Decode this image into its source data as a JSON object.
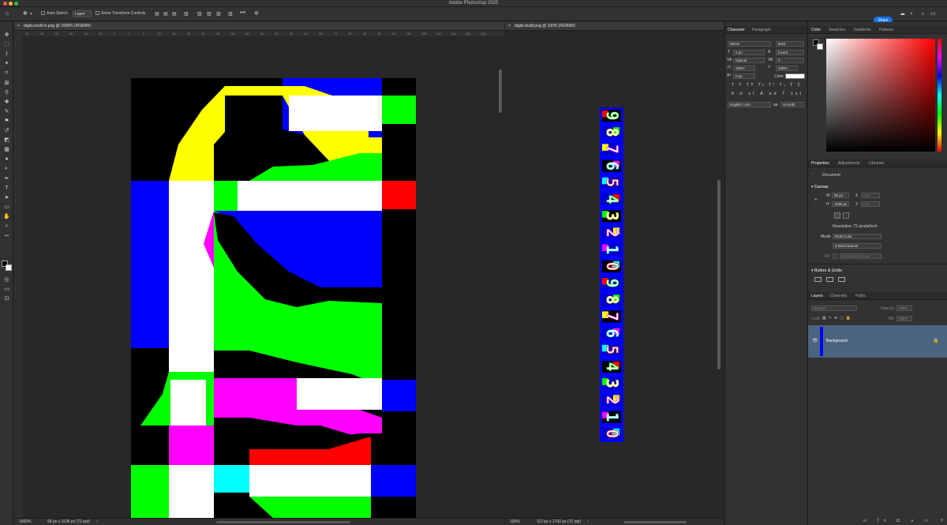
{
  "app": {
    "title": "Adobe Photoshop 2025"
  },
  "options_bar": {
    "auto_select_label": "Auto-Select:",
    "auto_select_value": "Layer",
    "show_transform_label": "Show Transform Controls",
    "share_label": "Share"
  },
  "tools": [
    "move-tool",
    "marquee-tool",
    "lasso-tool",
    "magic-wand-tool",
    "crop-tool",
    "frame-tool",
    "eyedropper-tool",
    "healing-tool",
    "brush-tool",
    "stamp-tool",
    "history-brush-tool",
    "eraser-tool",
    "gradient-tool",
    "blur-tool",
    "dodge-tool",
    "pen-tool",
    "type-tool",
    "path-select-tool",
    "rectangle-tool",
    "hand-tool",
    "zoom-tool",
    "more-tools"
  ],
  "doc_left": {
    "tab_label": "digits.msdf.m.png @ 1600% (RGB/8#)",
    "ruler_ticks": [
      "35",
      "30",
      "25",
      "20",
      "15",
      "10",
      "5",
      "0",
      "5",
      "10",
      "15",
      "20",
      "25",
      "30",
      "35",
      "40",
      "45",
      "50",
      "55",
      "60",
      "65",
      "70",
      "75",
      "80",
      "85",
      "90",
      "95",
      "100",
      "105",
      "110",
      "115",
      "120"
    ],
    "zoom": "1600%",
    "info": "96 px x 1536 px (72 ppi)"
  },
  "doc_right": {
    "tab_label": "digits.msdf.png @ 100% (RGB/8#)",
    "zoom": "100%",
    "info": "112 px x 1792 px (72 ppi)",
    "glyphs": [
      "9",
      "8",
      "7",
      "6",
      "5",
      "4",
      "3",
      "2",
      "1",
      "0",
      "9",
      "8",
      "7",
      "6",
      "5",
      "4",
      "3",
      "2",
      "1",
      "0"
    ]
  },
  "character_panel": {
    "tabs": [
      "Character",
      "Paragraph"
    ],
    "font_family": "Menlo",
    "font_style": "Bold",
    "font_size": "2 px",
    "leading": "(Auto)",
    "kerning": "Optical",
    "tracking": "0",
    "vscale": "100%",
    "hscale": "100%",
    "baseline": "0 px",
    "color_label": "Color:",
    "language": "English: USA",
    "aa_label": "aa",
    "antialias": "Smooth"
  },
  "color_panel": {
    "tabs": [
      "Color",
      "Swatches",
      "Gradients",
      "Patterns"
    ],
    "hue": "#ff0000"
  },
  "properties_panel": {
    "tabs": [
      "Properties",
      "Adjustments",
      "Libraries"
    ],
    "document_label": "Document",
    "canvas_label": "Canvas",
    "w_label": "W",
    "w_value": "96 px",
    "x_label": "X",
    "x_placeholder": "0 px",
    "h_label": "H",
    "h_value": "1536 px",
    "y_label": "Y",
    "y_placeholder": "0 px",
    "resolution": "Resolution: 72 pixels/inch",
    "mode_label": "Mode",
    "mode_value": "RGB Color",
    "depth_value": "8 Bits/Channel",
    "fill_label": "Fill",
    "fill_value": "Background Color",
    "rulers_label": "Rulers & Grids"
  },
  "layers_panel": {
    "tabs": [
      "Layers",
      "Channels",
      "Paths"
    ],
    "blend_mode": "Normal",
    "opacity_label": "Opacity:",
    "opacity_value": "100%",
    "lock_label": "Lock:",
    "fill_label": "Fill:",
    "fill_value": "100%",
    "layers": [
      {
        "name": "Background"
      }
    ]
  }
}
